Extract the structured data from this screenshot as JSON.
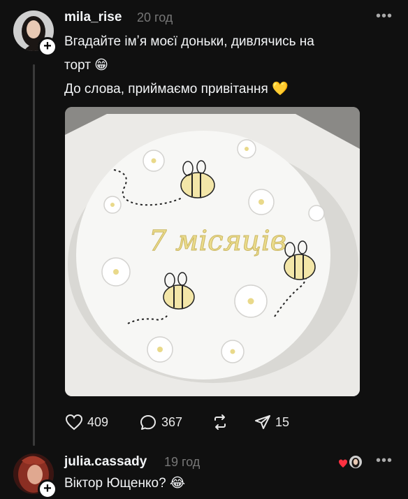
{
  "post": {
    "username": "mila_rise",
    "time": "20 год",
    "more": "•••",
    "line1": "Вгадайте імʼя моєї доньки, дивлячись на",
    "line2": "торт 😁",
    "line3": "До слова, приймаємо привітання 💛",
    "photo": {
      "cake_text": "7 місяців"
    },
    "actions": {
      "likes": "409",
      "comments": "367",
      "shares": "15"
    }
  },
  "reply": {
    "username": "julia.cassady",
    "time": "19 год",
    "more": "•••",
    "text": "Віктор Ющенко? 😂"
  },
  "colors": {
    "background": "#101010",
    "like_heart": "#ff3040"
  }
}
